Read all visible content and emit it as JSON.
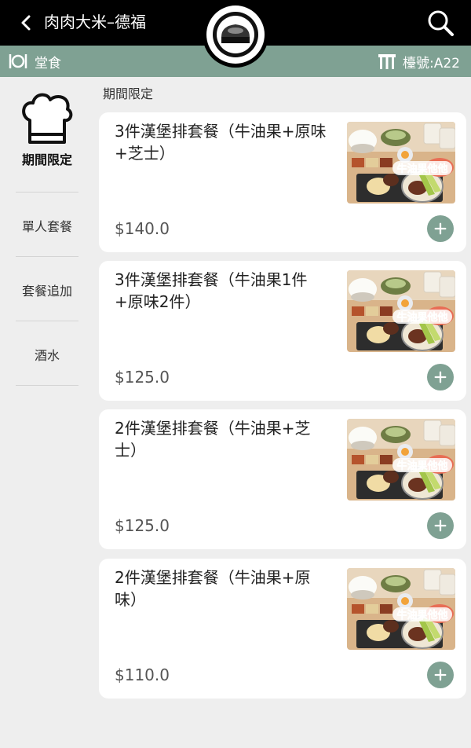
{
  "header": {
    "store_name": "肉肉大米–德福"
  },
  "subbar": {
    "dine_label": "堂食",
    "table_label": "檯號:A22"
  },
  "sidebar": {
    "items": [
      {
        "label": "期間限定"
      },
      {
        "label": "單人套餐"
      },
      {
        "label": "套餐追加"
      },
      {
        "label": "酒水"
      }
    ]
  },
  "section": {
    "title": "期間限定"
  },
  "products": [
    {
      "name": "3件漢堡排套餐（牛油果+原味+芝士）",
      "price": "$140.0"
    },
    {
      "name": "3件漢堡排套餐（牛油果1件+原味2件）",
      "price": "$125.0"
    },
    {
      "name": "2件漢堡排套餐（牛油果+芝士）",
      "price": "$125.0"
    },
    {
      "name": "2件漢堡排套餐（牛油果+原味）",
      "price": "$110.0"
    }
  ],
  "image_badge": "牛油果他他",
  "colors": {
    "header": "#000000",
    "accent": "#7fa193",
    "background": "#eeeeee"
  },
  "icons": [
    "back-icon",
    "logo-icon",
    "search-icon",
    "dining-icon",
    "table-icon",
    "chef-hat-icon",
    "add-icon"
  ]
}
